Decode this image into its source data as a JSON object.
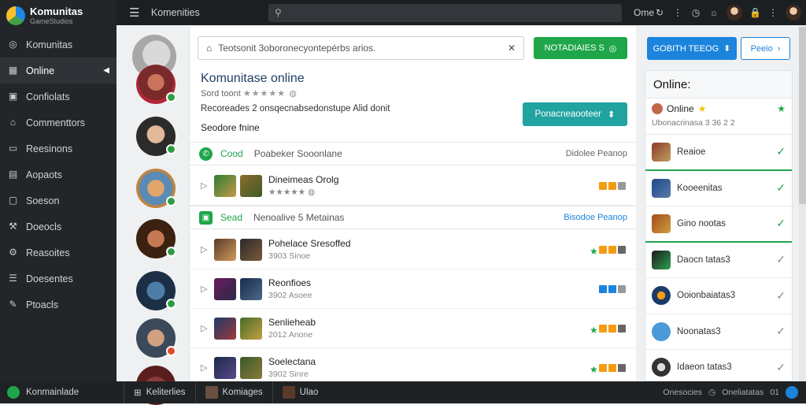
{
  "app": {
    "title": "Komunitas",
    "subtitle": "GameStudios"
  },
  "sidebar": {
    "items": [
      {
        "label": "Komunitas",
        "icon": "compass-icon"
      },
      {
        "label": "Online",
        "icon": "grid-icon",
        "active": true
      },
      {
        "label": "Confiolats",
        "icon": "chat-icon"
      },
      {
        "label": "Commenttors",
        "icon": "home-icon"
      },
      {
        "label": "Reesinons",
        "icon": "monitor-icon"
      },
      {
        "label": "Aopaots",
        "icon": "box-icon"
      },
      {
        "label": "Soeson",
        "icon": "doc-icon"
      },
      {
        "label": "Doeocls",
        "icon": "tool-icon"
      },
      {
        "label": "Reasoites",
        "icon": "settings-icon"
      },
      {
        "label": "Doesentes",
        "icon": "list-icon"
      },
      {
        "label": "Ptoacls",
        "icon": "pen-icon"
      }
    ]
  },
  "topbar": {
    "title": "Komenities",
    "mode": "Ome"
  },
  "main": {
    "search_placeholder": "Teotsonit 3oboronecyontepérbs arios.",
    "green_button": "NOTADIAIES S",
    "title": "Komunitase online",
    "rating_label": "Sord toont",
    "description": "Recoreades 2 onsqecnabsedonstupe Alid donit",
    "subtitle": "Seodore fnine",
    "teal_button": "Ponacneaooteer",
    "sections": [
      {
        "tag": "Cood",
        "name": "Poabeker Sooonlane",
        "right": "Didolee Peanop"
      },
      {
        "tag": "Sead",
        "name": "Nenoalive 5 Metainas",
        "right": "Bisodoe Peanop"
      }
    ],
    "rows": [
      {
        "title": "Dineimeas Orolg",
        "meta": ""
      },
      {
        "title": "Pohelace Sresoffed",
        "meta": "3903 Sinoe"
      },
      {
        "title": "Reonfioes",
        "meta": "3902 Asoee"
      },
      {
        "title": "Senlieheab",
        "meta": "2012 Anone"
      },
      {
        "title": "Soelectana",
        "meta": "3902 Sinre"
      }
    ]
  },
  "right": {
    "blue_button": "GOBITH TEEOG",
    "outline_button": "Peeio",
    "panel_title": "Online:",
    "user": {
      "name": "Online",
      "meta": "Ubonacrinasa 3 36 2 2"
    },
    "items": [
      {
        "label": "Reaioe",
        "selected": true
      },
      {
        "label": "Kooeenitas"
      },
      {
        "label": "Gino  nootas",
        "selected": true
      },
      {
        "label": "Daocn tatas3"
      },
      {
        "label": "Ooionbaiatas3"
      },
      {
        "label": "Noonatas3"
      },
      {
        "label": "Idaeon tatas3"
      }
    ]
  },
  "bottombar": {
    "brand": "Konmainlade",
    "items": [
      "Keliterlies",
      "Komiages",
      "Ulao"
    ],
    "right": [
      "Onesocies",
      "Oneliatatas",
      "01"
    ]
  },
  "colors": {
    "green": "#1fa64a",
    "teal": "#21a3a0",
    "blue": "#1b84dc",
    "sidebar": "#232629"
  }
}
